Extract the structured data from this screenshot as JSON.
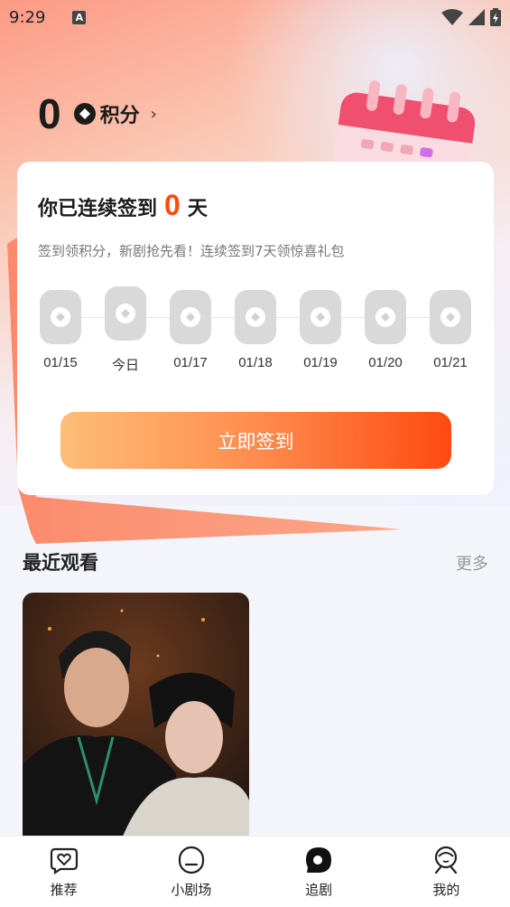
{
  "status_bar": {
    "time": "9:29",
    "indicator": "A",
    "icons": [
      "wifi-icon",
      "signal-icon",
      "battery-icon"
    ]
  },
  "points": {
    "value": "0",
    "label": "积分",
    "arrow": "›"
  },
  "checkin_card": {
    "title_prefix": "你已连续签到",
    "days": "0",
    "title_suffix": "天",
    "subtitle": "签到领积分，新剧抢先看！连续签到7天领惊喜礼包",
    "day_labels": [
      "01/15",
      "今日",
      "01/17",
      "01/18",
      "01/19",
      "01/20",
      "01/21"
    ],
    "button_label": "立即签到"
  },
  "recent": {
    "title": "最近观看",
    "more": "更多"
  },
  "tabs": [
    {
      "label": "推荐",
      "icon": "heart-bubble-icon"
    },
    {
      "label": "小剧场",
      "icon": "theater-icon"
    },
    {
      "label": "追剧",
      "icon": "follow-drama-icon"
    },
    {
      "label": "我的",
      "icon": "profile-icon"
    }
  ],
  "colors": {
    "accent": "#ff4a0e",
    "button_start": "#fdbe79",
    "button_end": "#ff4a10"
  }
}
